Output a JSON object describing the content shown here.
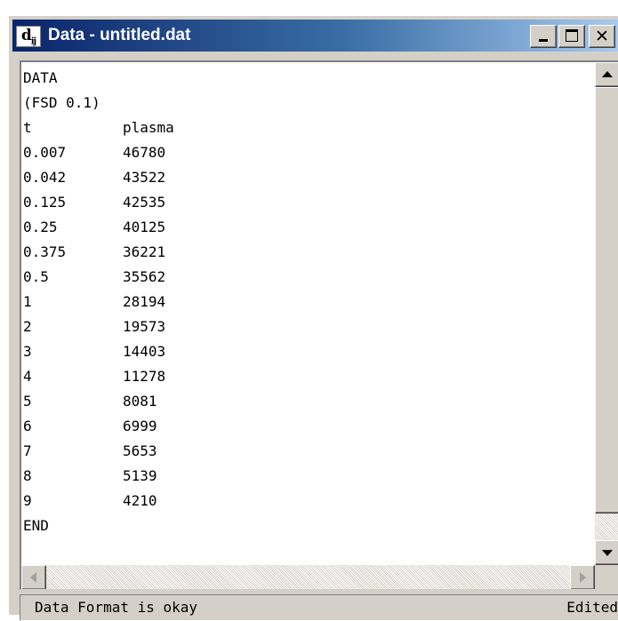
{
  "window": {
    "icon_main": "d",
    "icon_sub": "ij",
    "title": "Data - untitled.dat",
    "close_glyph": "✕"
  },
  "editor": {
    "lines": [
      {
        "t": "DATA",
        "v": ""
      },
      {
        "t": "(FSD 0.1)",
        "v": ""
      },
      {
        "t": "t",
        "v": "plasma"
      },
      {
        "t": "0.007",
        "v": "46780"
      },
      {
        "t": "0.042",
        "v": "43522"
      },
      {
        "t": "0.125",
        "v": "42535"
      },
      {
        "t": "0.25",
        "v": "40125"
      },
      {
        "t": "0.375",
        "v": "36221"
      },
      {
        "t": "0.5",
        "v": "35562"
      },
      {
        "t": "1",
        "v": "28194"
      },
      {
        "t": "2",
        "v": "19573"
      },
      {
        "t": "3",
        "v": "14403"
      },
      {
        "t": "4",
        "v": "11278"
      },
      {
        "t": "5",
        "v": "8081"
      },
      {
        "t": "6",
        "v": "6999"
      },
      {
        "t": "7",
        "v": "5653"
      },
      {
        "t": "8",
        "v": "5139"
      },
      {
        "t": "9",
        "v": "4210"
      },
      {
        "t": "END",
        "v": ""
      }
    ]
  },
  "status": {
    "message": "Data Format is okay",
    "state": "Edited"
  },
  "colors": {
    "titlebar_start": "#0a246a",
    "titlebar_end": "#a6caf0",
    "chrome": "#d4d0c8"
  }
}
